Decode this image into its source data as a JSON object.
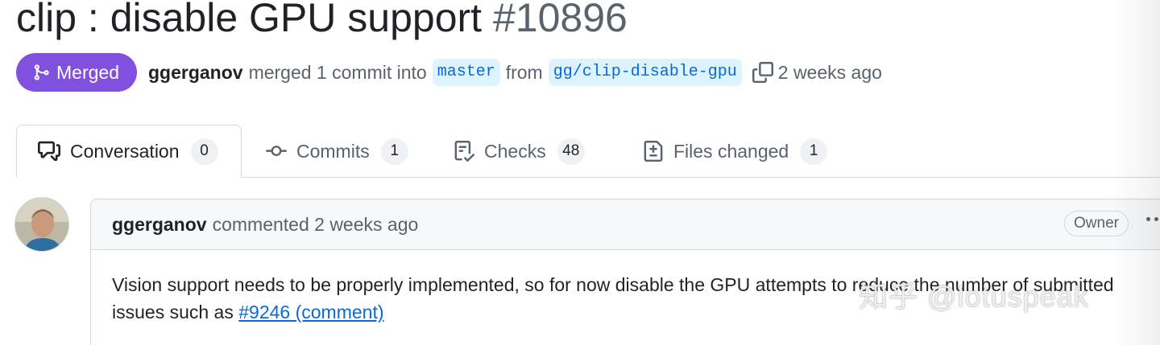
{
  "pr": {
    "title": "clip : disable GPU support",
    "number": "#10896"
  },
  "meta": {
    "state": "Merged",
    "author": "ggerganov",
    "merged_text": "merged 1 commit into",
    "base_branch": "master",
    "from_text": "from",
    "head_branch": "gg/clip-disable-gpu",
    "time": "2 weeks ago"
  },
  "tabs": [
    {
      "label": "Conversation",
      "count": "0",
      "icon": "comment-discussion-icon"
    },
    {
      "label": "Commits",
      "count": "1",
      "icon": "git-commit-icon"
    },
    {
      "label": "Checks",
      "count": "48",
      "icon": "checklist-icon"
    },
    {
      "label": "Files changed",
      "count": "1",
      "icon": "file-diff-icon"
    }
  ],
  "comment": {
    "author": "ggerganov",
    "action": "commented 2 weeks ago",
    "role_badge": "Owner",
    "body_line1": "Vision support needs to be properly implemented, so for now disable the GPU attempts to reduce the number of submitted",
    "body_prefix": "issues such as",
    "link_text": "#9246 (comment)"
  },
  "watermark": "知乎 @lotuspeak",
  "colors": {
    "merged": "#8250df",
    "link": "#0969da",
    "branch_bg": "#ddf4ff"
  }
}
